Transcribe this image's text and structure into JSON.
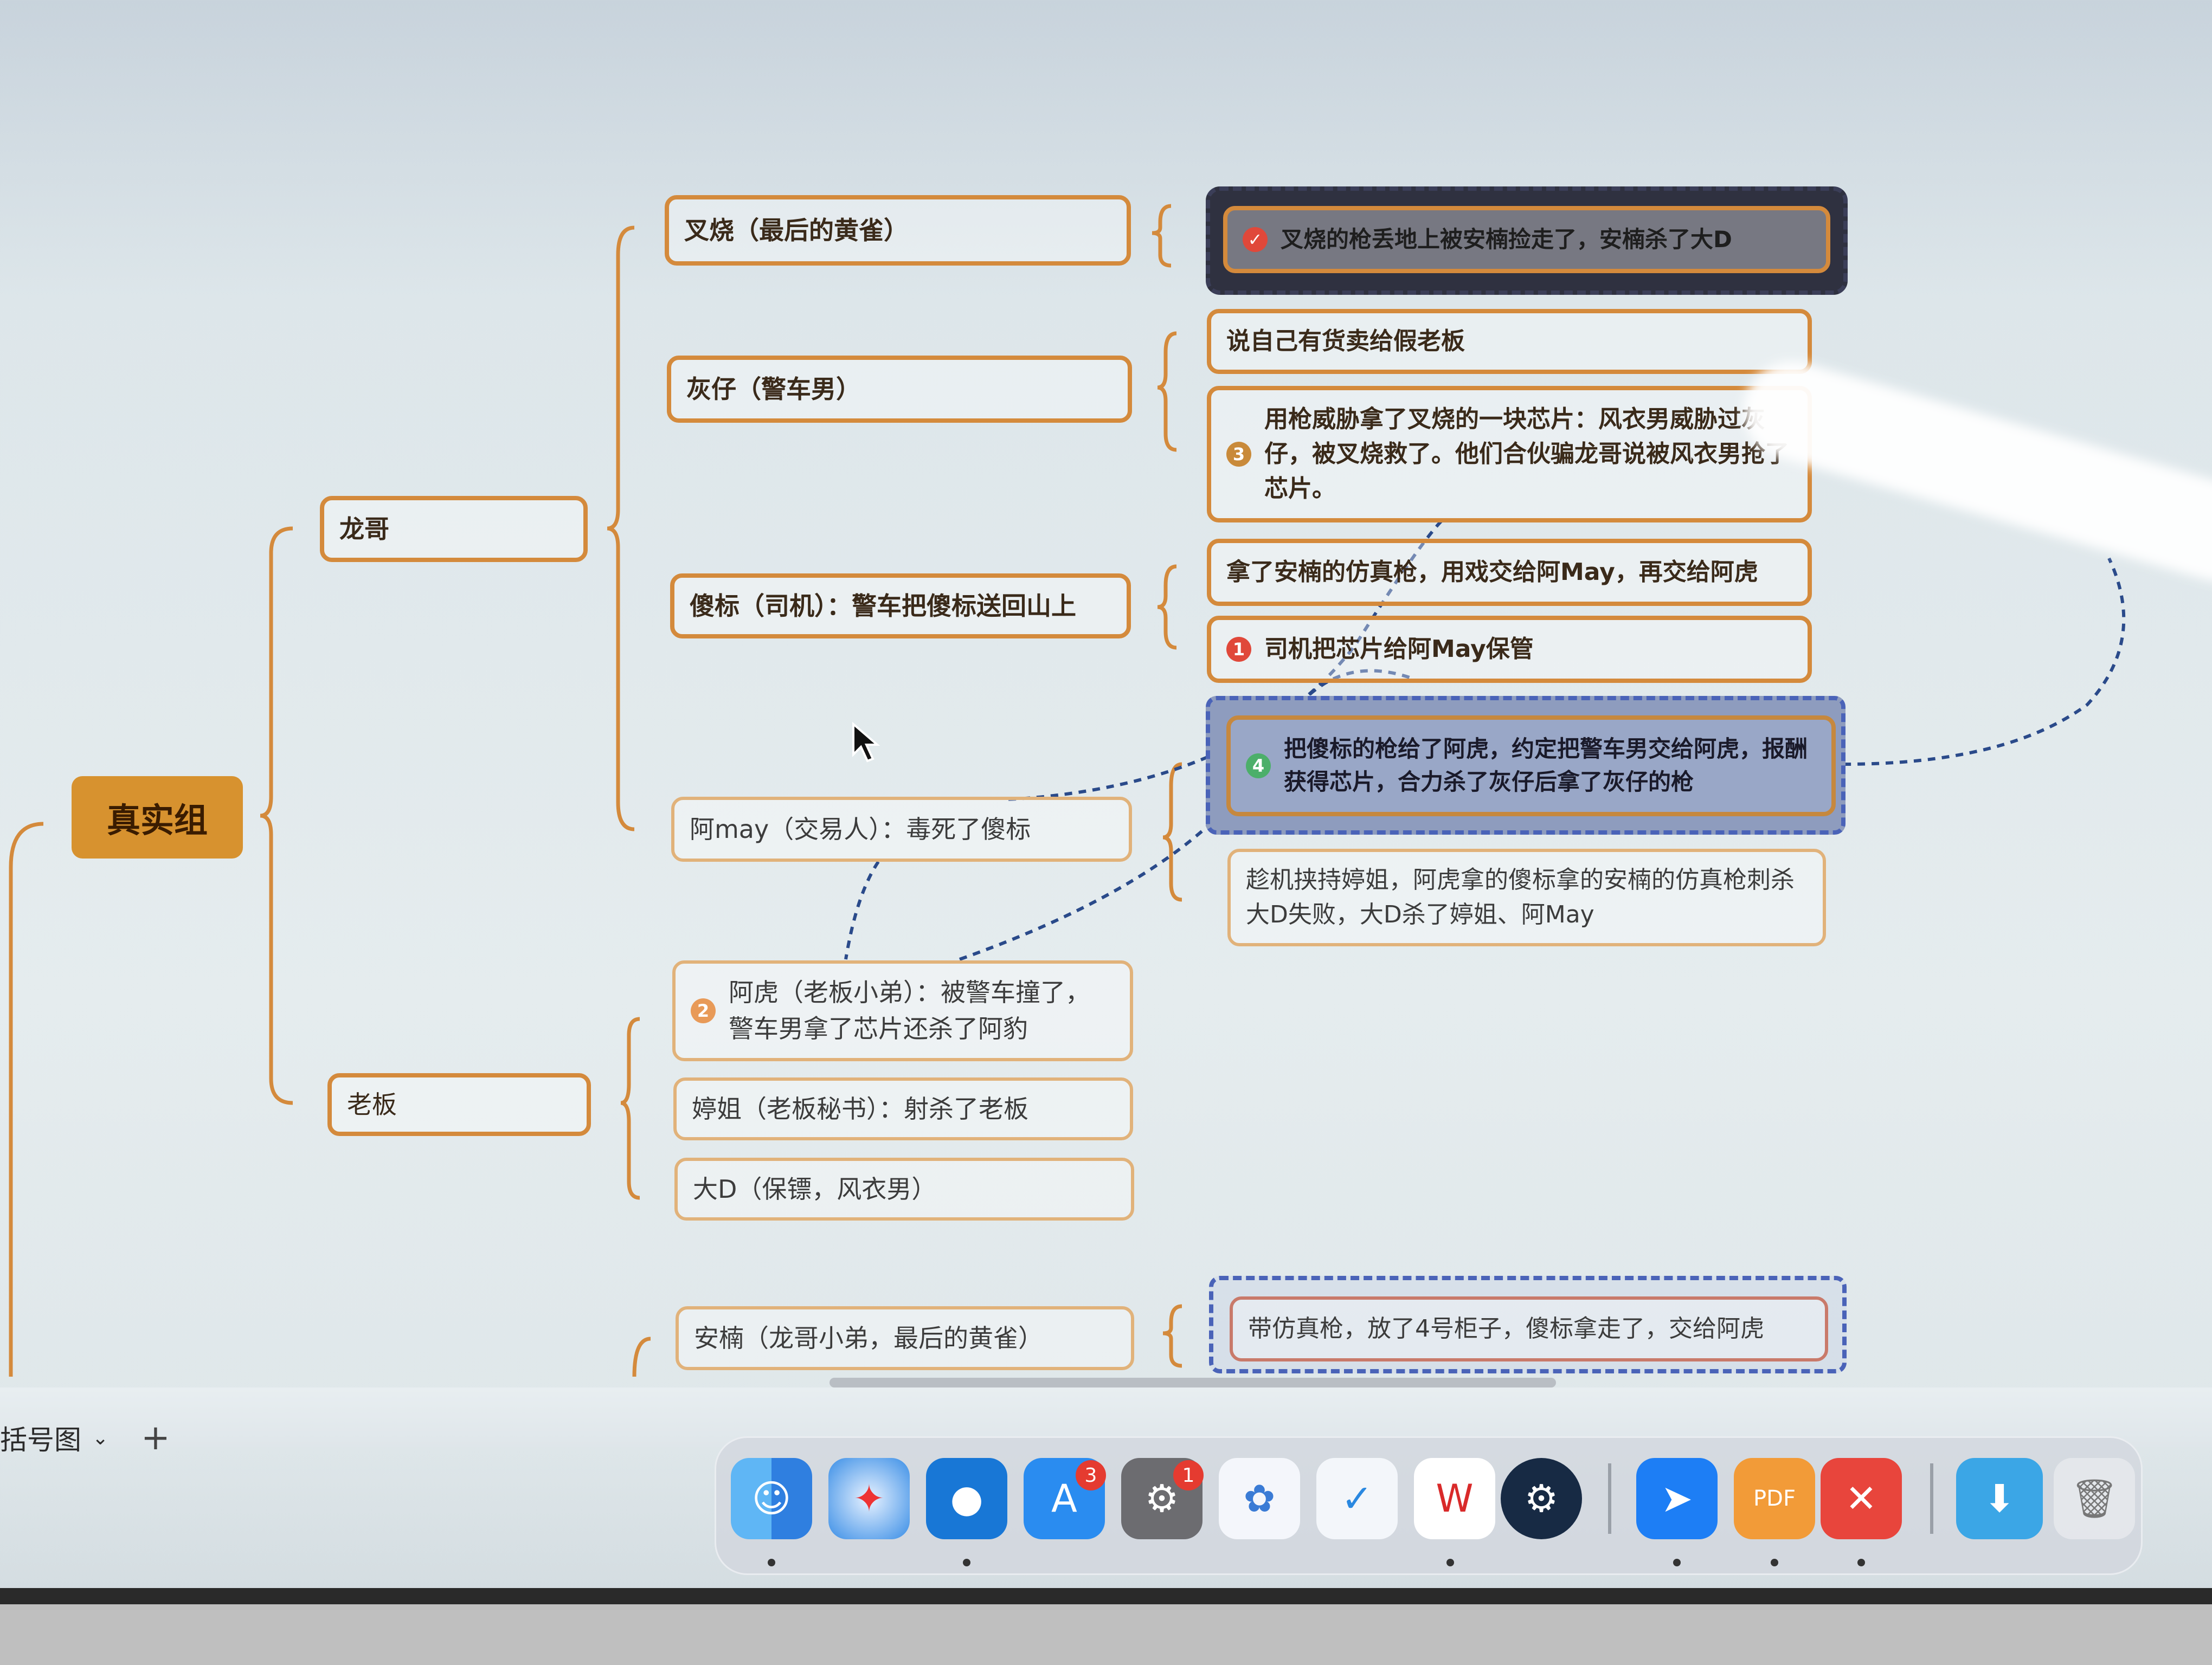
{
  "mindmap": {
    "root": "真实组",
    "branches": [
      {
        "label": "龙哥"
      },
      {
        "label": "老板"
      }
    ],
    "nodes": {
      "chashao": "叉烧（最后的黄雀）",
      "huizai": "灰仔（警车男）",
      "shabiao": "傻标（司机）：警车把傻标送回山上",
      "amay": "阿may（交易人）：毒死了傻标",
      "ahu": "阿虎（老板小弟）：被警车撞了，警车男拿了芯片还杀了阿豹",
      "tingjie": "婷姐（老板秘书）：射杀了老板",
      "dad": "大D（保镖，风衣男）",
      "annan": "安楠（龙哥小弟，最后的黄雀）"
    },
    "details": {
      "chashao_1": "叉烧的枪丢地上被安楠捡走了，安楠杀了大D",
      "huizai_1": "说自己有货卖给假老板",
      "huizai_2": "用枪威胁拿了叉烧的一块芯片：风衣男威胁过灰仔，被叉烧救了。他们合伙骗龙哥说被风衣男抢了芯片。",
      "shabiao_1": "拿了安楠的仿真枪，用戏交给阿May，再交给阿虎",
      "shabiao_2": "司机把芯片给阿May保管",
      "amay_1": "把傻标的枪给了阿虎，约定把警车男交给阿虎，报酬获得芯片，合力杀了灰仔后拿了灰仔的枪",
      "amay_2": "趁机挟持婷姐，阿虎拿的傻标拿的安楠的仿真枪刺杀大D失败，大D杀了婷姐、阿May",
      "annan_1": "带仿真枪，放了4号柜子，傻标拿走了，交给阿虎"
    },
    "markers": {
      "m1": "1",
      "m2": "2",
      "m3": "3",
      "m4": "4"
    }
  },
  "toolbar": {
    "sheet_name": "括号图",
    "add": "+"
  },
  "dock": {
    "apps": [
      "finder-icon",
      "safari-icon",
      "browser-icon",
      "app-store-icon",
      "system-settings-icon",
      "cloud-drive-icon",
      "tasks-icon",
      "wps-icon",
      "steam-icon",
      "feishu-icon",
      "pdf-expert-icon",
      "xmind-icon",
      "downloads-folder-icon",
      "trash-icon"
    ],
    "badges": {
      "app_store": "3",
      "system_settings": "1"
    }
  }
}
